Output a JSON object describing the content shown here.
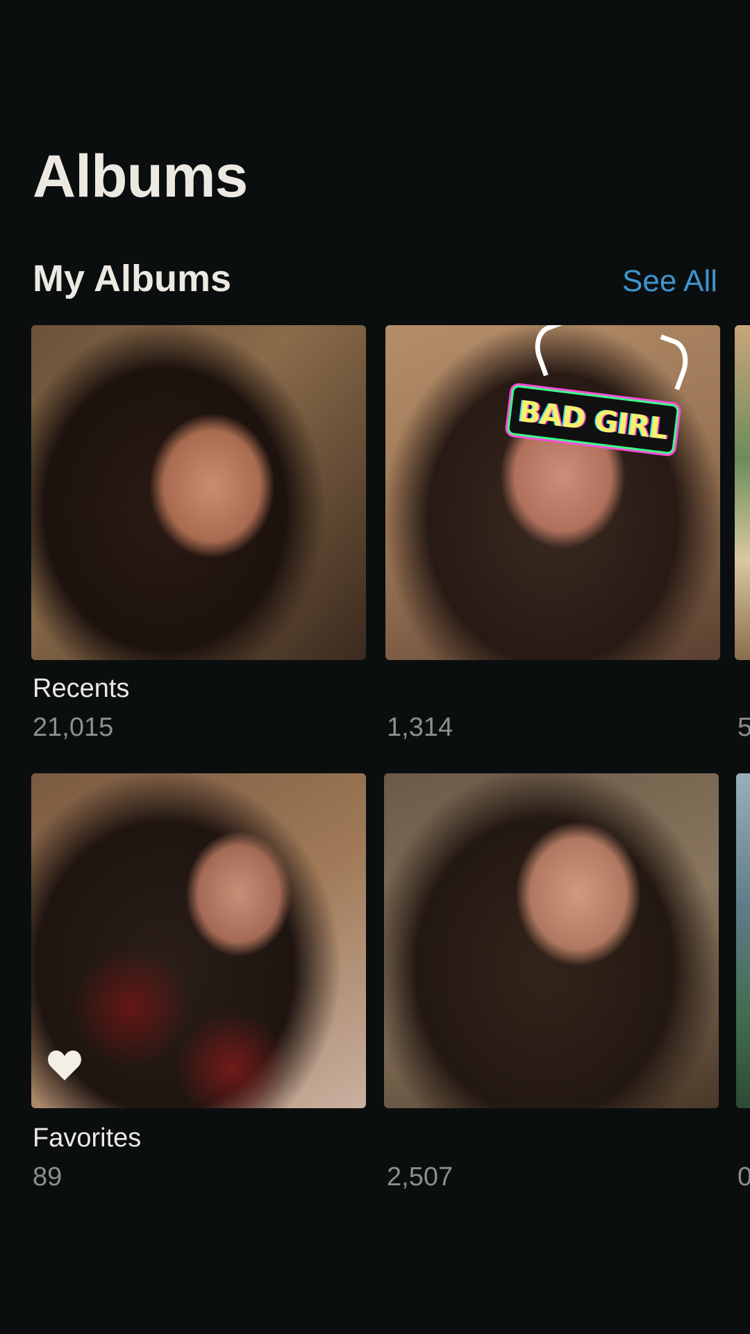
{
  "header": {
    "title": "Albums"
  },
  "my_albums": {
    "title": "My Albums",
    "see_all_label": "See All",
    "row1": [
      {
        "name": "Recents",
        "count": "21,015"
      },
      {
        "name": "",
        "count": "1,314",
        "sticker_text": "BAD GIRL"
      },
      {
        "name": "",
        "count": "5"
      }
    ],
    "row2": [
      {
        "name": "Favorites",
        "count": "89",
        "badge_icon": "heart-icon"
      },
      {
        "name": "",
        "count": "2,507"
      },
      {
        "name": "",
        "count": "0"
      }
    ]
  },
  "colors": {
    "background": "#0b0e0f",
    "accent": "#3d95cf",
    "secondary_text": "#8e8e8e"
  }
}
